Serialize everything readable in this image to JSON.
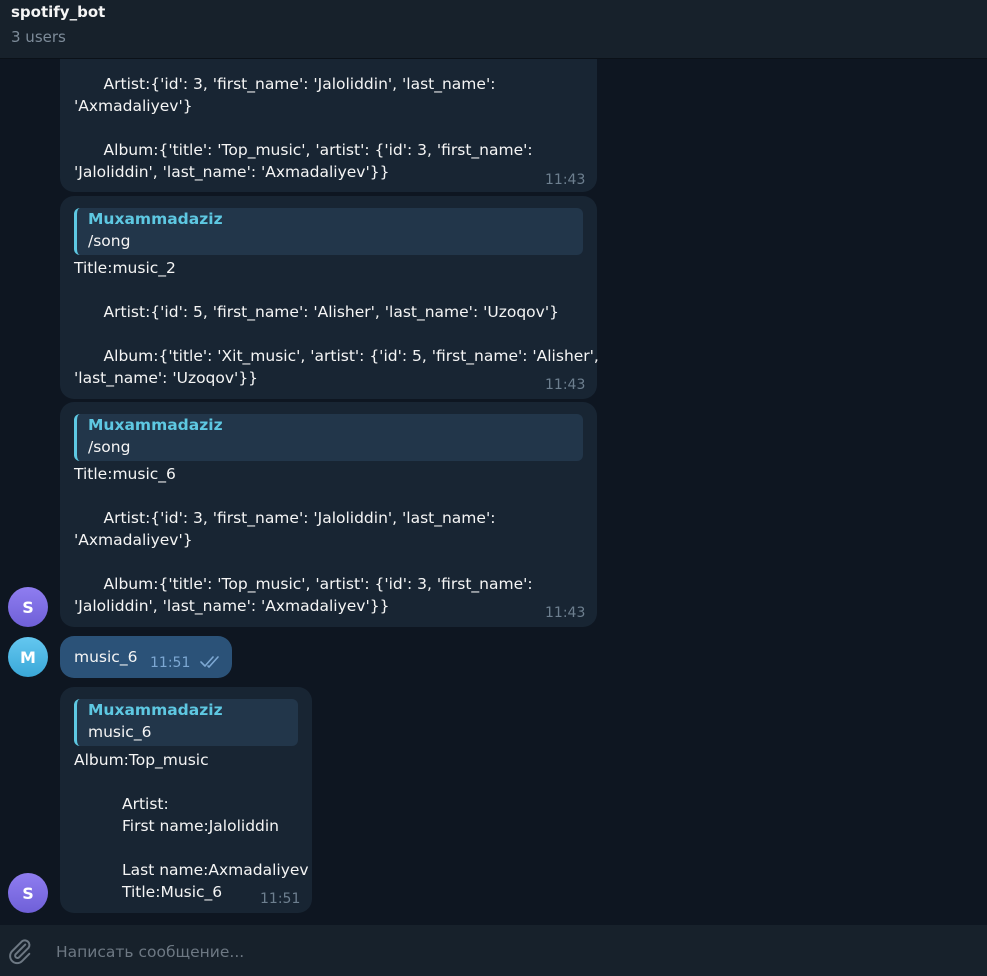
{
  "header": {
    "title": "spotify_bot",
    "subtitle": "3 users"
  },
  "messages": {
    "m1": {
      "lines": [
        "      Artist:{'id': 3, 'first_name': 'Jaloliddin', 'last_name':",
        "'Axmadaliyev'}",
        "      Album:{'title': 'Top_music', 'artist': {'id': 3, 'first_name':",
        "'Jaloliddin', 'last_name': 'Axmadaliyev'}}"
      ],
      "time": "11:43"
    },
    "m2": {
      "quote_name": "Muxammadaziz",
      "quote_text": "/song",
      "lines": [
        "Title:music_2",
        "      Artist:{'id': 5, 'first_name': 'Alisher', 'last_name': 'Uzoqov'}",
        "      Album:{'title': 'Xit_music', 'artist': {'id': 5, 'first_name': 'Alisher',",
        "'last_name': 'Uzoqov'}}"
      ],
      "time": "11:43"
    },
    "m3": {
      "quote_name": "Muxammadaziz",
      "quote_text": "/song",
      "lines": [
        "Title:music_6",
        "      Artist:{'id': 3, 'first_name': 'Jaloliddin', 'last_name':",
        "'Axmadaliyev'}",
        "      Album:{'title': 'Top_music', 'artist': {'id': 3, 'first_name':",
        "'Jaloliddin', 'last_name': 'Axmadaliyev'}}"
      ],
      "time": "11:43",
      "avatar": "S"
    },
    "m4": {
      "text": "music_6",
      "time": "11:51",
      "avatar": "M"
    },
    "m5": {
      "quote_name": "Muxammadaziz",
      "quote_text": "music_6",
      "lines": [
        "Album:Top_music",
        "Artist:",
        "First name:Jaloliddin",
        "Last name:Axmadaliyev",
        "Title:Music_6"
      ],
      "time": "11:51",
      "avatar": "S"
    }
  },
  "composer": {
    "placeholder": "Написать сообщение...",
    "attach_icon": "paperclip-icon"
  },
  "colors": {
    "accent": "#5ec8e2",
    "outgoing": "#2b5278",
    "incoming": "#182533",
    "background": "#0e1621"
  }
}
